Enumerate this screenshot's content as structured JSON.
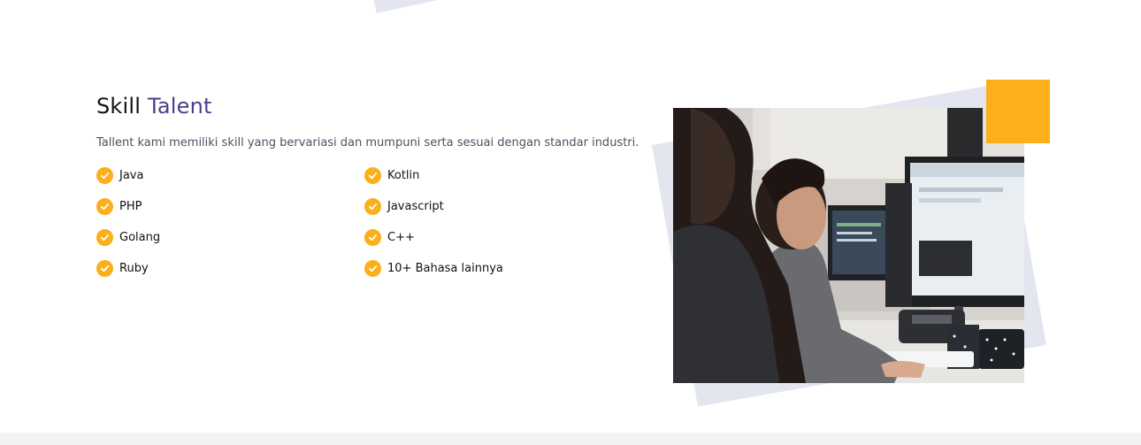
{
  "section": {
    "title_main": "Skill",
    "title_accent": "Talent",
    "description": "Tallent kami memiliki skill yang bervariasi dan mumpuni serta sesuai dengan standar industri."
  },
  "skills": [
    {
      "label": "Java"
    },
    {
      "label": "Kotlin"
    },
    {
      "label": "PHP"
    },
    {
      "label": "Javascript"
    },
    {
      "label": "Golang"
    },
    {
      "label": "C++"
    },
    {
      "label": "Ruby"
    },
    {
      "label": "10+ Bahasa lainnya"
    }
  ],
  "icons": {
    "skill_check": "check-circle-icon"
  },
  "colors": {
    "accent_purple": "#4b3f8f",
    "accent_orange": "#fbaf1a",
    "shape_gray": "#e3e6ef",
    "footer_gray": "#f1f2f3"
  }
}
